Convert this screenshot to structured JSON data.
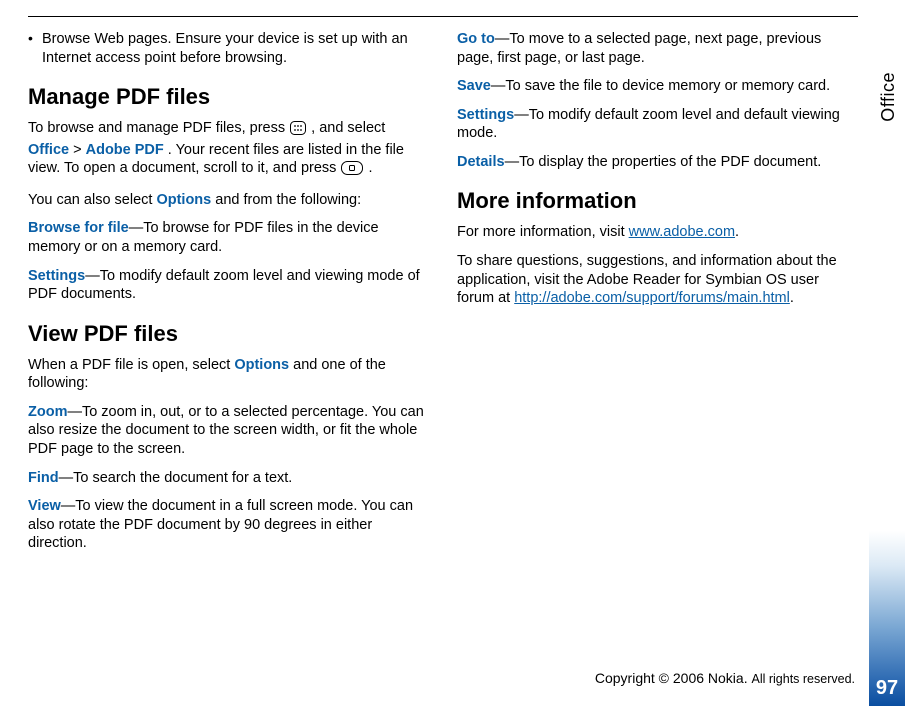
{
  "side_label": "Office",
  "page_number": "97",
  "col1": {
    "bullet": "Browse Web pages. Ensure your device is set up with an Internet access point before browsing.",
    "h_manage": "Manage PDF files",
    "manage_pre": "To browse and manage PDF files, press ",
    "manage_mid1": ", and select ",
    "kw_office": "Office",
    "gt": " > ",
    "kw_adobe": "Adobe PDF",
    "manage_post": ". Your recent files are listed in the file view. To open a document, scroll to it, and press ",
    "manage_end": ".",
    "you_can": "You can also select ",
    "kw_options": "Options",
    "you_can_post": " and from the following:",
    "kw_browse": "Browse for file",
    "browse_def": "—To browse for PDF files in the device memory or on a memory card.",
    "kw_settings1": "Settings",
    "settings1_def": "—To modify default zoom level and viewing mode of PDF documents.",
    "h_view": "View PDF files",
    "view_intro_pre": "When a PDF file is open, select ",
    "view_intro_post": " and one of the following:",
    "kw_zoom": "Zoom",
    "zoom_def": "—To zoom in, out, or to a selected percentage. You can also resize the document to the screen width, or fit the whole PDF page to the screen.",
    "kw_find": "Find",
    "find_def": "—To search the document for a text.",
    "kw_view": "View",
    "view_def": "—To view the document in a full screen mode. You can also rotate the PDF document by 90 degrees in either direction."
  },
  "col2": {
    "kw_goto": "Go to",
    "goto_def": "—To move to a selected page, next page, previous page, first page, or last page.",
    "kw_save": "Save",
    "save_def": "—To save the file to device memory or memory card.",
    "kw_settings2": "Settings",
    "settings2_def": "—To modify default zoom level and default viewing mode.",
    "kw_details": "Details",
    "details_def": "—To display the properties of the PDF document.",
    "h_more": "More information",
    "more1_pre": "For more information, visit ",
    "link1": "www.adobe.com",
    "more1_post": ".",
    "more2_pre": "To share questions, suggestions, and information about the application, visit the Adobe Reader for Symbian OS user forum at ",
    "link2": "http://adobe.com/support/forums/main.html",
    "more2_post": "."
  },
  "footer": {
    "copyright_strong": "Copyright © 2006 Nokia. ",
    "copyright_rest": "All rights reserved."
  }
}
